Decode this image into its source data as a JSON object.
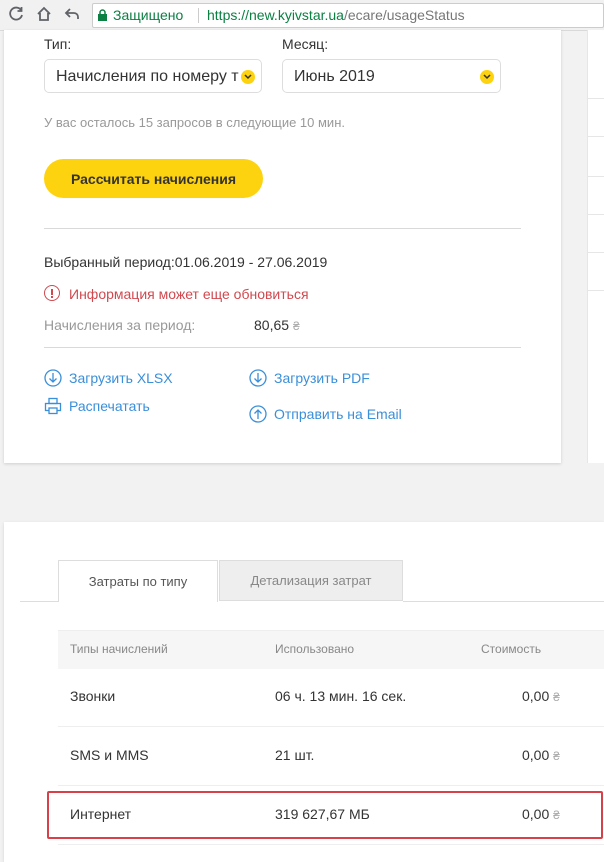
{
  "browser": {
    "secure_label": "Защищено",
    "url_host": "https://new.kyivstar.ua",
    "url_path": "/ecare/usageStatus"
  },
  "form": {
    "type_label": "Тип:",
    "type_value": "Начисления по номеру т",
    "month_label": "Месяц:",
    "month_value": "Июнь 2019",
    "requests_hint": "У вас осталось 15 запросов в следующие 10 мин.",
    "calc_button": "Рассчитать начисления"
  },
  "summary": {
    "period_label": "Выбранный период:01.06.2019 - 27.06.2019",
    "warning": "Информация может еще обновиться",
    "charges_label": "Начисления за период:",
    "charges_value": "80,65",
    "currency": "₴"
  },
  "actions": {
    "download_xlsx": "Загрузить XLSX",
    "download_pdf": "Загрузить PDF",
    "print": "Распечатать",
    "send_email": "Отправить на Email"
  },
  "tabs": {
    "by_type": "Затраты по типу",
    "details": "Детализация затрат"
  },
  "table": {
    "headers": [
      "Типы начислений",
      "Использовано",
      "Стоимость"
    ],
    "rows": [
      {
        "type": "Звонки",
        "used": "06 ч. 13 мин. 16 сек.",
        "cost": "0,00"
      },
      {
        "type": "SMS и MMS",
        "used": "21 шт.",
        "cost": "0,00"
      },
      {
        "type": "Интернет",
        "used": "319 627,67 МБ",
        "cost": "0,00"
      }
    ]
  },
  "colors": {
    "accent_yellow": "#fdd20f",
    "link_blue": "#3a8fd9",
    "warning_red": "#d0494f",
    "secure_green": "#0b8043"
  }
}
